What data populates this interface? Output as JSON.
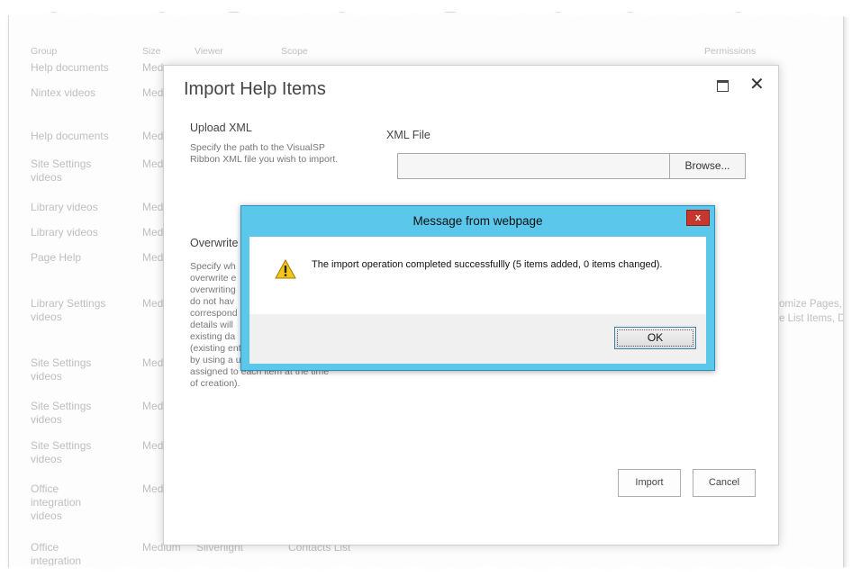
{
  "background_list": {
    "headers": {
      "group": "Group",
      "size": "Size",
      "viewer": "Viewer",
      "scope": "Scope",
      "permissions": "Permissions"
    },
    "rows": [
      {
        "group": "Help documents",
        "size": "Med"
      },
      {
        "group": "Nintex videos",
        "size": "Med"
      },
      {
        "group": "Help documents",
        "size": "Med"
      },
      {
        "group": "Site Settings videos",
        "size": "Med"
      },
      {
        "group": "Library videos",
        "size": "Med"
      },
      {
        "group": "Library videos",
        "size": "Med"
      },
      {
        "group": "Page Help",
        "size": "Med"
      },
      {
        "group": "Library Settings videos",
        "size": "Med"
      },
      {
        "group": "Site Settings videos",
        "size": "Med"
      },
      {
        "group": "Site Settings videos",
        "size": "Med"
      },
      {
        "group": "Site Settings videos",
        "size": "Med"
      },
      {
        "group": "Office integration videos",
        "size": "Med"
      },
      {
        "group": "Office integration",
        "size": "Medium",
        "viewer": "Silverlight",
        "scope": "Contacts List"
      }
    ],
    "permissions_partial": [
      "omize Pages,",
      "e List Items, D"
    ]
  },
  "dialog": {
    "title": "Import Help Items",
    "upload_title": "Upload XML",
    "upload_desc": "Specify the path to the VisualSP Ribbon XML file you wish to import.",
    "xml_label": "XML File",
    "xml_value": "",
    "browse_label": "Browse...",
    "overwrite_title": "Overwrite",
    "overwrite_desc_lines": [
      "Specify wh",
      "overwrite e",
      "overwriting",
      "do not hav",
      "correspond",
      "details will",
      "existing da",
      "(existing entries are determined",
      "by using a unique identifier",
      "assigned to each item at the time",
      "of creation)."
    ],
    "import_label": "Import",
    "cancel_label": "Cancel"
  },
  "message": {
    "title": "Message from webpage",
    "close_label": "x",
    "text": "The import operation completed successfullly (5 items added, 0 items changed).",
    "ok_label": "OK"
  },
  "colors": {
    "message_title_bar": "#5bc7ea",
    "close_red": "#c8372d",
    "warning_yellow": "#f5c518"
  },
  "icons": {
    "warning": "warning-triangle",
    "maximize": "maximize-icon",
    "close": "close-icon"
  }
}
